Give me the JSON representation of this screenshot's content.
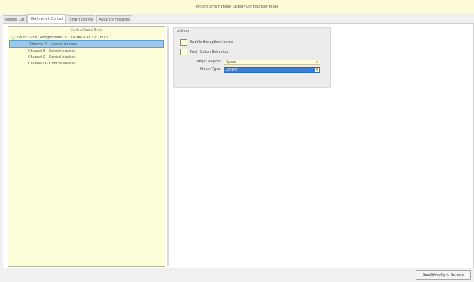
{
  "window": {
    "title": "Adlight Smart Phone Display Configurator Panel"
  },
  "tabs": [
    {
      "label": "Region List"
    },
    {
      "label": "Wall-switch Control"
    },
    {
      "label": "Smart Engine"
    },
    {
      "label": "Advance Features"
    }
  ],
  "tree": {
    "header": "Control/Input Units",
    "root": "INTELLIGENT Adlight9000F1C : 0A3AV20A032C1F009",
    "children": [
      "Channel A - Control devices",
      "Channel B - Control devices",
      "Channel C - Control devices",
      "Channel D - Control devices"
    ]
  },
  "actions": {
    "title": "Actions",
    "enable_label": "Enable the options below",
    "push_label": "Push Button Behaviour",
    "target_region_label": "Target Region:",
    "target_region_value": "Kyoon",
    "action_type_label": "Action Type:",
    "action_type_value": "On/Off"
  },
  "footer": {
    "save_label": "Save&Modify to Servers"
  }
}
